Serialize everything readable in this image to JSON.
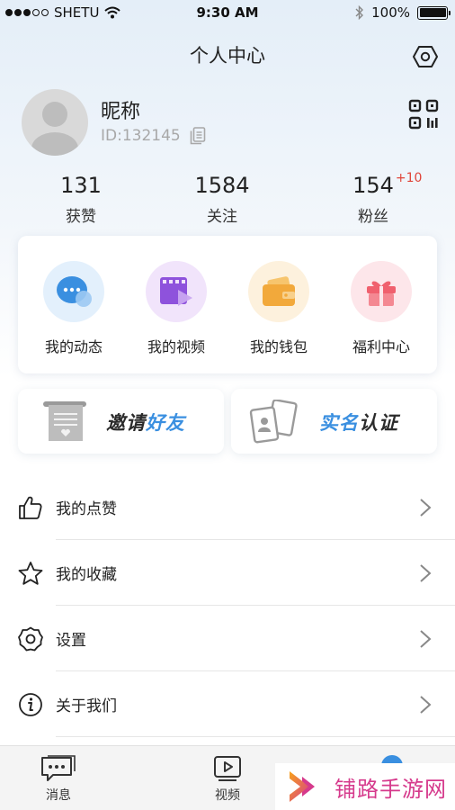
{
  "status_bar": {
    "carrier": "SHETU",
    "time": "9:30 AM",
    "battery": "100%",
    "battery_level": 1.0
  },
  "header": {
    "title": "个人中心",
    "settings_icon": "hexagon-settings-icon"
  },
  "profile": {
    "nickname": "昵称",
    "user_id": "ID:132145",
    "copy_icon": "copy-icon",
    "qr_icon": "qr-code-icon"
  },
  "stats": [
    {
      "value": "131",
      "label": "获赞",
      "delta": ""
    },
    {
      "value": "1584",
      "label": "关注",
      "delta": ""
    },
    {
      "value": "154",
      "label": "粉丝",
      "delta": "+10"
    }
  ],
  "quick_actions": [
    {
      "label": "我的动态",
      "icon": "chat-bubble-icon",
      "bg": "#e3f0fc",
      "color": "#3a8fe0"
    },
    {
      "label": "我的视频",
      "icon": "video-film-icon",
      "bg": "#f1e4fb",
      "color": "#9a5ee0"
    },
    {
      "label": "我的钱包",
      "icon": "wallet-icon",
      "bg": "#fdf1dd",
      "color": "#f2a93b"
    },
    {
      "label": "福利中心",
      "icon": "gift-icon",
      "bg": "#fde6ea",
      "color": "#f0606e"
    }
  ],
  "promos": {
    "invite": {
      "part1": "邀请",
      "part2": "好友",
      "icon": "invite-scroll-icon"
    },
    "verify": {
      "part1": "实名",
      "part2": "认证",
      "icon": "id-cards-icon"
    }
  },
  "menu": [
    {
      "label": "我的点赞",
      "icon": "thumbs-up-icon"
    },
    {
      "label": "我的收藏",
      "icon": "star-icon"
    },
    {
      "label": "设置",
      "icon": "gear-icon"
    },
    {
      "label": "关于我们",
      "icon": "info-icon"
    }
  ],
  "tabbar": {
    "messages": "消息",
    "video": "视频"
  },
  "watermark": {
    "text": "铺路手游网"
  },
  "colors": {
    "accent": "#3a8fe0",
    "delta": "#e0453a",
    "watermark": "#d63a8c"
  }
}
